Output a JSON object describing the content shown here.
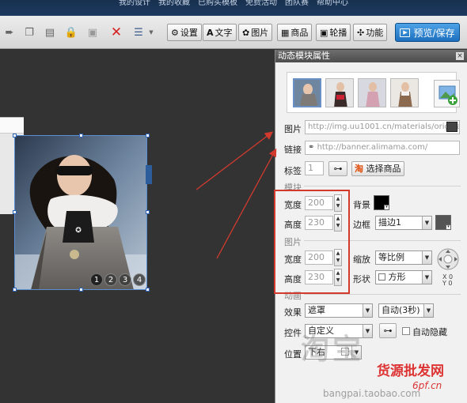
{
  "topnav": {
    "items": [
      "我的设计",
      "我的收藏",
      "已购买模板",
      "免费活动",
      "团队赛",
      "帮助中心"
    ]
  },
  "toolbar": {
    "buttons": [
      "设置",
      "文字",
      "图片",
      "商品",
      "轮播",
      "功能"
    ],
    "preview": "预览/保存"
  },
  "slider": {
    "dots": [
      "1",
      "2",
      "3",
      "4"
    ]
  },
  "panel": {
    "title": "动态模块属性",
    "labels": {
      "image": "图片",
      "link": "链接",
      "tag": "标签",
      "module_group": "模块",
      "width": "宽度",
      "height": "高度",
      "bg": "背景",
      "border": "边框",
      "image_group": "图片",
      "zoom": "缩放",
      "shape": "形状",
      "anim_group": "动画",
      "effect": "效果",
      "control": "控件",
      "position": "位置",
      "auto_hide": "自动隐藏"
    },
    "image_url": "http://img.uu1001.cn/materials/original",
    "link_url": "http://banner.alimama.com/",
    "tag_value": "1",
    "select_goods": "选择商品",
    "module_width": "200",
    "module_height": "230",
    "image_width": "200",
    "image_height": "230",
    "border_select": "描边1",
    "zoom_select": "等比例",
    "shape_select": "方形",
    "effect_select": "遮罩",
    "timing_select": "自动(3秒)",
    "control_select": "自定义",
    "position_select": "下右",
    "xy": [
      "X 0",
      "Y 0"
    ],
    "bg_color": "#000000",
    "border_color": "#555555"
  },
  "watermark": {
    "big": "淘宝",
    "url": "bangpai.taobao.com",
    "red": "货源批发网",
    "red_url": "6pf.cn"
  }
}
